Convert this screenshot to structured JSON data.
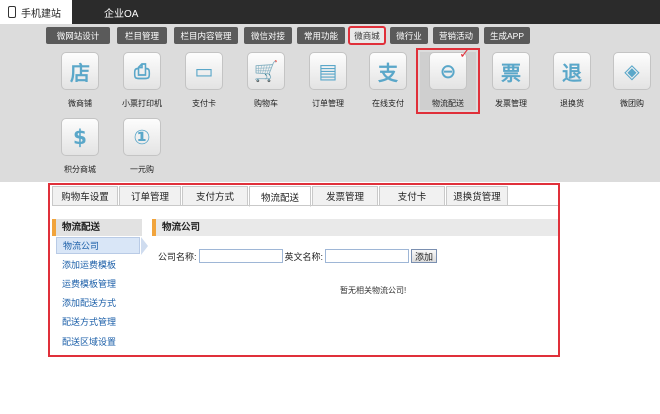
{
  "top_tabs": [
    {
      "label": "手机建站",
      "icon": "phone-icon",
      "active": true
    },
    {
      "label": "企业OA",
      "icon": "grid-icon",
      "active": false
    }
  ],
  "menu": [
    {
      "label": "微网站设计"
    },
    {
      "label": "栏目管理"
    },
    {
      "label": "栏目内容管理"
    },
    {
      "label": "微信对接"
    },
    {
      "label": "常用功能"
    },
    {
      "label": "微商城",
      "active": true
    },
    {
      "label": "微行业"
    },
    {
      "label": "营销活动"
    },
    {
      "label": "生成APP"
    }
  ],
  "modules": [
    {
      "label": "微商铺",
      "glyph": "店",
      "icon": "store-icon"
    },
    {
      "label": "小票打印机",
      "glyph": "⎙",
      "icon": "printer-icon"
    },
    {
      "label": "支付卡",
      "glyph": "▭",
      "icon": "card-icon"
    },
    {
      "label": "购物车",
      "glyph": "🛒",
      "icon": "cart-icon"
    },
    {
      "label": "订单管理",
      "glyph": "▤",
      "icon": "order-icon"
    },
    {
      "label": "在线支付",
      "glyph": "支",
      "icon": "pay-icon"
    },
    {
      "label": "物流配送",
      "glyph": "⊖",
      "icon": "steering-wheel-icon",
      "selected": true
    },
    {
      "label": "发票管理",
      "glyph": "票",
      "icon": "invoice-icon"
    },
    {
      "label": "退换货",
      "glyph": "退",
      "icon": "return-icon"
    },
    {
      "label": "微团购",
      "glyph": "◈",
      "icon": "tag-icon"
    },
    {
      "label": "积分商城",
      "glyph": "$",
      "icon": "points-mall-icon"
    },
    {
      "label": "一元购",
      "glyph": "①",
      "icon": "one-yuan-icon"
    }
  ],
  "sub_tabs": [
    {
      "label": "购物车设置"
    },
    {
      "label": "订单管理"
    },
    {
      "label": "支付方式"
    },
    {
      "label": "物流配送",
      "active": true
    },
    {
      "label": "发票管理"
    },
    {
      "label": "支付卡"
    },
    {
      "label": "退换货管理"
    }
  ],
  "sidebar": {
    "title": "物流配送",
    "items": [
      {
        "label": "物流公司",
        "active": true
      },
      {
        "label": "添加运费模板"
      },
      {
        "label": "运费模板管理"
      },
      {
        "label": "添加配送方式"
      },
      {
        "label": "配送方式管理"
      },
      {
        "label": "配送区域设置"
      }
    ]
  },
  "main": {
    "title": "物流公司",
    "company_label": "公司名称:",
    "company_value": "",
    "english_label": "英文名称:",
    "english_value": "",
    "add_button": "添加",
    "empty_text": "暂无相关物流公司!"
  },
  "colors": {
    "highlight": "#e0303a",
    "accent": "#f1a43c",
    "link": "#1a5ea8"
  }
}
